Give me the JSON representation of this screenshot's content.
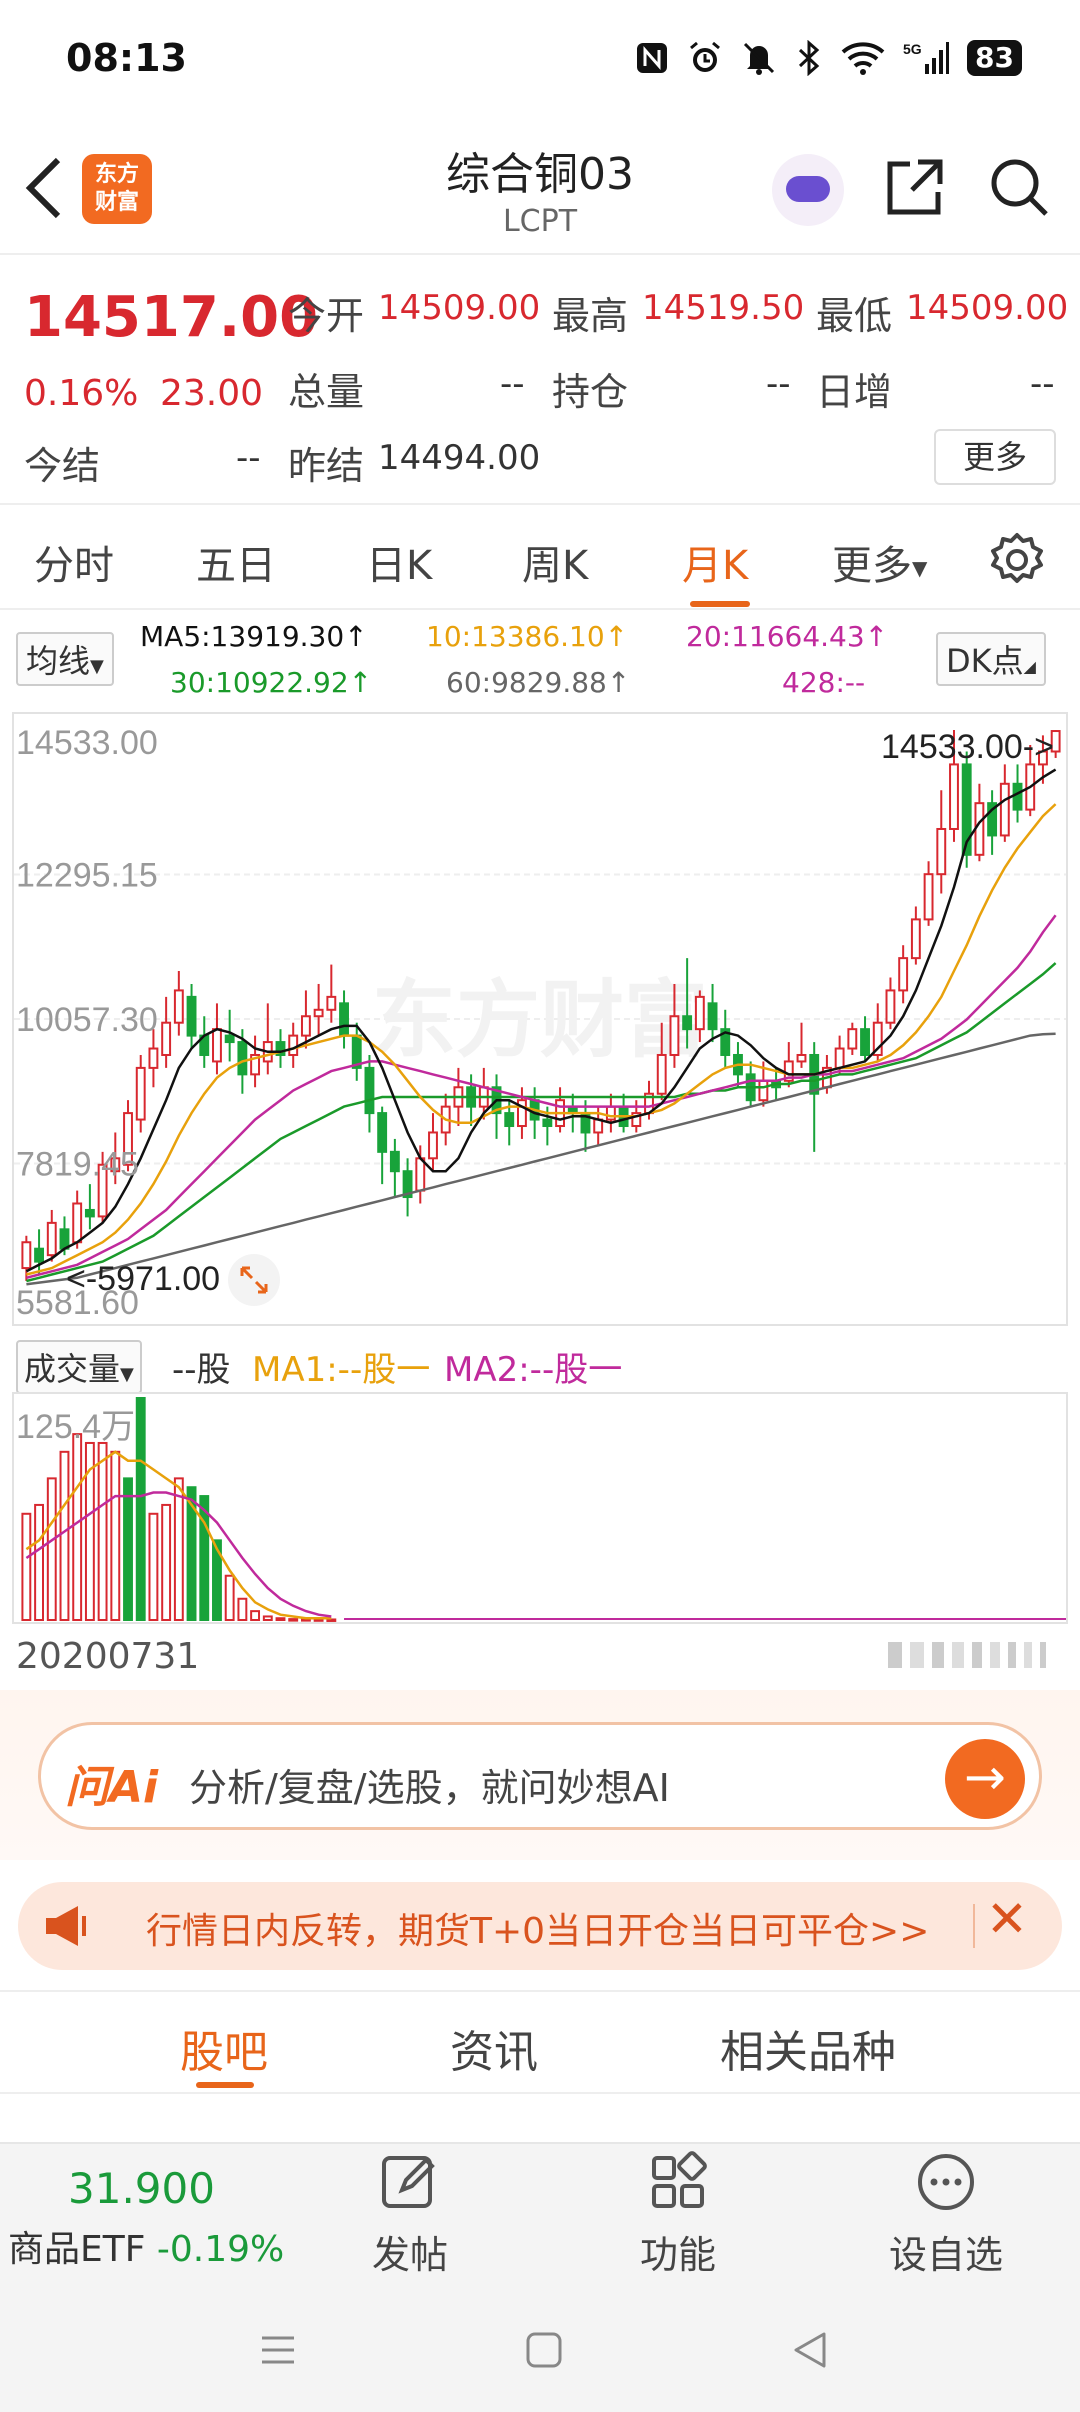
{
  "status_bar": {
    "time": "08:13",
    "icons": [
      "nfc-icon",
      "alarm-icon",
      "mute-icon",
      "bluetooth-icon",
      "wifi-icon",
      "5g-signal-icon"
    ],
    "network": "5G",
    "battery": "83"
  },
  "header": {
    "logo_line1": "东方",
    "logo_line2": "财富",
    "title": "综合铜03",
    "subtitle": "LCPT"
  },
  "quote": {
    "price": "14517.00",
    "change_pct": "0.16%",
    "change": "23.00",
    "open_label": "今开",
    "open": "14509.00",
    "high_label": "最高",
    "high": "14519.50",
    "low_label": "最低",
    "low": "14509.00",
    "volume_label": "总量",
    "volume": "--",
    "position_label": "持仓",
    "position": "--",
    "daily_inc_label": "日增",
    "daily_inc": "--",
    "settle_label": "今结",
    "settle": "--",
    "prev_settle_label": "昨结",
    "prev_settle": "14494.00",
    "more_label": "更多"
  },
  "tabs": {
    "items": [
      "分时",
      "五日",
      "日K",
      "周K",
      "月K",
      "更多"
    ],
    "active": "月K"
  },
  "ma": {
    "button": "均线",
    "ma5": "MA5:13919.30↑",
    "ma10": "10:13386.10↑",
    "ma20": "20:11664.43↑",
    "ma30": "30:10922.92↑",
    "ma60": "60:9829.88↑",
    "ma428": "428:--",
    "dk_button": "DK点",
    "colors": {
      "ma5": "#111111",
      "ma10": "#e8a10c",
      "ma20": "#c02a9c",
      "ma30": "#1a9a2a",
      "ma60": "#666666"
    }
  },
  "chart_data": {
    "type": "candlestick",
    "period": "monthly",
    "y_ticks": [
      "14533.00",
      "12295.15",
      "10057.30",
      "7819.45",
      "5581.60"
    ],
    "ylim": [
      5581.6,
      14533.0
    ],
    "max_marker": "14533.00->",
    "min_marker": "<-5971.00",
    "watermark": "东方财富",
    "candles": [
      [
        6200,
        6600,
        6000,
        6700
      ],
      [
        6500,
        6300,
        6100,
        6800
      ],
      [
        6400,
        6900,
        6300,
        7100
      ],
      [
        6800,
        6500,
        6400,
        7000
      ],
      [
        6600,
        7200,
        6500,
        7400
      ],
      [
        7100,
        7000,
        6800,
        7500
      ],
      [
        7000,
        7800,
        6900,
        8000
      ],
      [
        7700,
        7900,
        7500,
        8300
      ],
      [
        7800,
        8600,
        7700,
        8800
      ],
      [
        8500,
        9300,
        8300,
        9500
      ],
      [
        9300,
        9600,
        9000,
        9900
      ],
      [
        9500,
        10000,
        9300,
        10400
      ],
      [
        10000,
        10500,
        9800,
        10800
      ],
      [
        10400,
        9800,
        9600,
        10600
      ],
      [
        9800,
        9500,
        9300,
        10100
      ],
      [
        9400,
        9900,
        9200,
        10300
      ],
      [
        9800,
        9700,
        9400,
        10200
      ],
      [
        9700,
        9200,
        8900,
        9900
      ],
      [
        9200,
        9500,
        9000,
        9800
      ],
      [
        9400,
        9700,
        9200,
        10300
      ],
      [
        9700,
        9500,
        9300,
        9900
      ],
      [
        9500,
        9800,
        9300,
        10000
      ],
      [
        9800,
        10100,
        9600,
        10500
      ],
      [
        10100,
        10200,
        9800,
        10600
      ],
      [
        10200,
        10400,
        10000,
        10900
      ],
      [
        10300,
        9800,
        9600,
        10500
      ],
      [
        9800,
        9300,
        9100,
        10000
      ],
      [
        9300,
        8600,
        8300,
        9500
      ],
      [
        8600,
        8000,
        7500,
        8700
      ],
      [
        8000,
        7700,
        7300,
        8200
      ],
      [
        7700,
        7300,
        7000,
        7900
      ],
      [
        7400,
        7900,
        7200,
        8100
      ],
      [
        7900,
        8300,
        7700,
        8600
      ],
      [
        8300,
        8700,
        8100,
        8900
      ],
      [
        8700,
        9000,
        8400,
        9300
      ],
      [
        9000,
        8700,
        8400,
        9200
      ],
      [
        8700,
        9000,
        8500,
        9300
      ],
      [
        9000,
        8600,
        8200,
        9200
      ],
      [
        8600,
        8400,
        8100,
        8800
      ],
      [
        8400,
        8800,
        8200,
        9000
      ],
      [
        8800,
        8500,
        8200,
        9000
      ],
      [
        8500,
        8400,
        8100,
        8700
      ],
      [
        8400,
        8800,
        8300,
        9000
      ],
      [
        8700,
        8600,
        8300,
        8900
      ],
      [
        8600,
        8300,
        8000,
        8800
      ],
      [
        8300,
        8500,
        8100,
        8700
      ],
      [
        8500,
        8700,
        8300,
        8900
      ],
      [
        8700,
        8400,
        8300,
        8900
      ],
      [
        8400,
        8600,
        8300,
        8800
      ],
      [
        8600,
        8900,
        8500,
        9100
      ],
      [
        8900,
        9500,
        8800,
        10000
      ],
      [
        9500,
        10100,
        9300,
        10600
      ],
      [
        10100,
        9900,
        9600,
        11000
      ],
      [
        9900,
        10400,
        9700,
        10500
      ],
      [
        10300,
        9900,
        9700,
        10600
      ],
      [
        9900,
        9500,
        9300,
        10200
      ],
      [
        9500,
        9200,
        9000,
        9700
      ],
      [
        9200,
        8800,
        8700,
        9400
      ],
      [
        8800,
        9100,
        8700,
        9400
      ],
      [
        9100,
        9000,
        8800,
        9300
      ],
      [
        9100,
        9400,
        9000,
        9700
      ],
      [
        9400,
        9500,
        9300,
        10000
      ],
      [
        9500,
        8900,
        8000,
        9700
      ],
      [
        9000,
        9300,
        8900,
        9500
      ],
      [
        9300,
        9600,
        9200,
        9800
      ],
      [
        9600,
        9900,
        9500,
        10000
      ],
      [
        9900,
        9500,
        9400,
        10100
      ],
      [
        9500,
        10000,
        9400,
        10300
      ],
      [
        10000,
        10500,
        9900,
        10700
      ],
      [
        10500,
        11000,
        10300,
        11200
      ],
      [
        11000,
        11600,
        10900,
        11800
      ],
      [
        11600,
        12300,
        11500,
        12500
      ],
      [
        12300,
        13000,
        12000,
        13600
      ],
      [
        13000,
        14000,
        12800,
        14533
      ],
      [
        14000,
        12600,
        12400,
        14200
      ],
      [
        12600,
        13400,
        12500,
        13700
      ],
      [
        13400,
        12900,
        12600,
        13600
      ],
      [
        12900,
        13700,
        12800,
        14000
      ],
      [
        13700,
        13300,
        13100,
        14000
      ],
      [
        13300,
        14000,
        13200,
        14300
      ],
      [
        14000,
        14200,
        13700,
        14450
      ],
      [
        14200,
        14517,
        14100,
        14533
      ]
    ],
    "ma5": [
      6150,
      6250,
      6350,
      6500,
      6600,
      6750,
      6900,
      7150,
      7500,
      7900,
      8350,
      8800,
      9300,
      9600,
      9800,
      9900,
      9850,
      9750,
      9600,
      9550,
      9550,
      9600,
      9700,
      9800,
      9900,
      9950,
      9950,
      9700,
      9300,
      8800,
      8300,
      7900,
      7700,
      7700,
      7900,
      8300,
      8600,
      8800,
      8800,
      8700,
      8600,
      8550,
      8500,
      8550,
      8550,
      8500,
      8450,
      8500,
      8550,
      8600,
      8750,
      9000,
      9300,
      9600,
      9750,
      9850,
      9800,
      9650,
      9450,
      9300,
      9200,
      9200,
      9200,
      9250,
      9300,
      9350,
      9400,
      9600,
      9800,
      10100,
      10500,
      11000,
      11500,
      12100,
      12800,
      13100,
      13300,
      13450,
      13550,
      13650,
      13800,
      13919
    ],
    "ma10": [
      6100,
      6150,
      6200,
      6300,
      6400,
      6500,
      6600,
      6750,
      6950,
      7200,
      7500,
      7850,
      8250,
      8600,
      8900,
      9150,
      9300,
      9400,
      9450,
      9500,
      9550,
      9600,
      9650,
      9700,
      9750,
      9800,
      9800,
      9700,
      9550,
      9350,
      9100,
      8850,
      8650,
      8500,
      8450,
      8450,
      8550,
      8650,
      8700,
      8700,
      8650,
      8600,
      8600,
      8600,
      8600,
      8600,
      8550,
      8550,
      8550,
      8600,
      8650,
      8750,
      8900,
      9050,
      9200,
      9300,
      9350,
      9350,
      9300,
      9250,
      9200,
      9200,
      9200,
      9250,
      9300,
      9300,
      9350,
      9400,
      9500,
      9650,
      9850,
      10100,
      10400,
      10800,
      11200,
      11650,
      12050,
      12400,
      12700,
      12950,
      13200,
      13386
    ],
    "ma20": [
      6050,
      6100,
      6150,
      6200,
      6250,
      6350,
      6450,
      6550,
      6650,
      6800,
      6950,
      7100,
      7300,
      7500,
      7700,
      7900,
      8100,
      8300,
      8500,
      8650,
      8800,
      8950,
      9050,
      9150,
      9250,
      9300,
      9350,
      9400,
      9400,
      9350,
      9300,
      9250,
      9200,
      9150,
      9100,
      9050,
      9000,
      8950,
      8900,
      8850,
      8800,
      8750,
      8700,
      8700,
      8700,
      8700,
      8700,
      8700,
      8700,
      8700,
      8750,
      8800,
      8850,
      8900,
      8950,
      9000,
      9050,
      9100,
      9100,
      9100,
      9150,
      9150,
      9200,
      9200,
      9250,
      9250,
      9300,
      9350,
      9400,
      9450,
      9550,
      9650,
      9750,
      9900,
      10050,
      10250,
      10450,
      10650,
      10850,
      11100,
      11400,
      11664
    ],
    "ma30": [
      6000,
      6050,
      6100,
      6150,
      6200,
      6250,
      6300,
      6400,
      6500,
      6600,
      6700,
      6850,
      7000,
      7150,
      7300,
      7450,
      7600,
      7750,
      7900,
      8050,
      8200,
      8300,
      8400,
      8500,
      8600,
      8700,
      8750,
      8800,
      8850,
      8850,
      8850,
      8850,
      8850,
      8850,
      8850,
      8850,
      8850,
      8850,
      8850,
      8850,
      8850,
      8850,
      8850,
      8850,
      8850,
      8850,
      8850,
      8850,
      8850,
      8850,
      8850,
      8850,
      8900,
      8900,
      8950,
      8950,
      9000,
      9000,
      9000,
      9050,
      9050,
      9100,
      9100,
      9150,
      9200,
      9200,
      9250,
      9300,
      9350,
      9400,
      9450,
      9550,
      9650,
      9750,
      9850,
      10000,
      10150,
      10300,
      10450,
      10600,
      10750,
      10923
    ],
    "ma60": [
      5950,
      5975,
      6000,
      6025,
      6050,
      6100,
      6150,
      6200,
      6250,
      6300,
      6350,
      6400,
      6450,
      6500,
      6550,
      6600,
      6650,
      6700,
      6750,
      6800,
      6850,
      6900,
      6950,
      7000,
      7050,
      7100,
      7150,
      7200,
      7250,
      7300,
      7350,
      7400,
      7450,
      7500,
      7550,
      7600,
      7650,
      7700,
      7750,
      7800,
      7850,
      7900,
      7950,
      8000,
      8050,
      8100,
      8150,
      8200,
      8250,
      8300,
      8350,
      8400,
      8450,
      8500,
      8550,
      8600,
      8650,
      8700,
      8750,
      8800,
      8850,
      8900,
      8950,
      9000,
      9050,
      9100,
      9150,
      9200,
      9250,
      9300,
      9350,
      9400,
      9450,
      9500,
      9550,
      9600,
      9650,
      9700,
      9750,
      9800,
      9820,
      9830
    ]
  },
  "volume": {
    "button": "成交量",
    "unit_label": "--股",
    "ma1": "MA1:--股一",
    "ma2": "MA2:--股一",
    "max_label": "125.4万",
    "date_label": "20200731",
    "bars": [
      60,
      65,
      80,
      95,
      105,
      100,
      100,
      95,
      80,
      125.4,
      60,
      65,
      80,
      75,
      70,
      45,
      25,
      12,
      5,
      2,
      1,
      0.5,
      0.5,
      0.4,
      0.3
    ],
    "bar_colors": [
      "r",
      "r",
      "r",
      "r",
      "r",
      "r",
      "r",
      "r",
      "g",
      "g",
      "r",
      "r",
      "r",
      "g",
      "g",
      "g",
      "r",
      "r",
      "r",
      "r",
      "r",
      "r",
      "r",
      "r",
      "r"
    ],
    "ma1_line": [
      40,
      45,
      55,
      65,
      75,
      85,
      90,
      95,
      90,
      90,
      85,
      80,
      75,
      65,
      55,
      40,
      28,
      18,
      10,
      6,
      3,
      2,
      1,
      1,
      1
    ],
    "ma2_line": [
      35,
      40,
      45,
      50,
      55,
      60,
      65,
      70,
      70,
      70,
      72,
      72,
      70,
      68,
      62,
      55,
      45,
      35,
      26,
      18,
      12,
      8,
      5,
      3,
      2
    ]
  },
  "ai": {
    "logo": "问Ai",
    "placeholder": "分析/复盘/选股，就问妙想AI"
  },
  "notice": {
    "text": "行情日内反转，期货T+0当日开仓当日可平仓>>"
  },
  "bottom_tabs": {
    "items": [
      "股吧",
      "资讯",
      "相关品种"
    ],
    "active": "股吧"
  },
  "bottom_nav": {
    "etf_price": "31.900",
    "etf_name": "商品ETF",
    "etf_change": "-0.19%",
    "post": "发帖",
    "func": "功能",
    "watchlist": "设自选"
  }
}
